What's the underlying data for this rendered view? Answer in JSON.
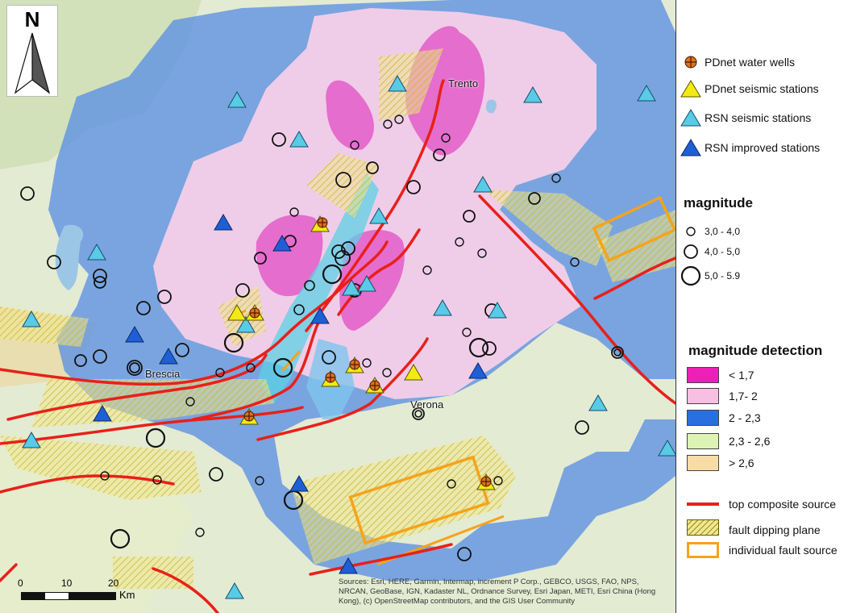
{
  "map": {
    "places": [
      {
        "id": "trento",
        "label": "Trento"
      },
      {
        "id": "brescia",
        "label": "Brescia"
      },
      {
        "id": "verona",
        "label": "Verona"
      }
    ],
    "north_label": "N",
    "scale": {
      "ticks": [
        "0",
        "10",
        "20"
      ],
      "unit": "Km"
    },
    "attribution": "Sources: Esri, HERE, Garmin, Intermap, increment P Corp., GEBCO, USGS, FAO, NPS, NRCAN, GeoBase, IGN, Kadaster NL, Ordnance Survey, Esri Japan, METI, Esri China (Hong Kong), (c) OpenStreetMap contributors, and the GIS User Community"
  },
  "legend": {
    "stations": [
      {
        "icon": "water-well-icon",
        "label": "PDnet water wells"
      },
      {
        "icon": "yellow-triangle-icon",
        "label": "PDnet  seismic stations"
      },
      {
        "icon": "cyan-triangle-icon",
        "label": "RSN  seismic stations"
      },
      {
        "icon": "blue-triangle-icon",
        "label": "RSN improved stations"
      }
    ],
    "magnitude_title": "magnitude",
    "magnitudes": [
      {
        "label": "3,0 - 4,0",
        "size": "small"
      },
      {
        "label": "4,0 - 5,0",
        "size": "medium"
      },
      {
        "label": "5,0 - 5.9",
        "size": "large"
      }
    ],
    "detection_title": "magnitude detection",
    "detection": [
      {
        "label": "< 1,7",
        "color": "#ee1fb4"
      },
      {
        "label": "1,7- 2",
        "color": "#f7c0e3"
      },
      {
        "label": "2 - 2,3",
        "color": "#2a6fe0"
      },
      {
        "label": "2,3 - 2,6",
        "color": "#dcf3b4"
      },
      {
        "label": "> 2,6",
        "color": "#f8dca8"
      }
    ],
    "faults": [
      {
        "icon": "red-line-icon",
        "label": "top composite source"
      },
      {
        "icon": "hatched-box-icon",
        "label": "fault dipping plane"
      },
      {
        "icon": "orange-box-icon",
        "label": "individual fault source"
      }
    ]
  },
  "colors": {
    "base": "#e4ecd6",
    "blue_zone": "#6f9ee6",
    "pink_zone": "#f4cde6",
    "magenta_zone": "#e55fc9",
    "fault_red": "#e8201a",
    "fault_orange": "#f5a31a",
    "hatch_yellow": "#e8dc6a"
  }
}
